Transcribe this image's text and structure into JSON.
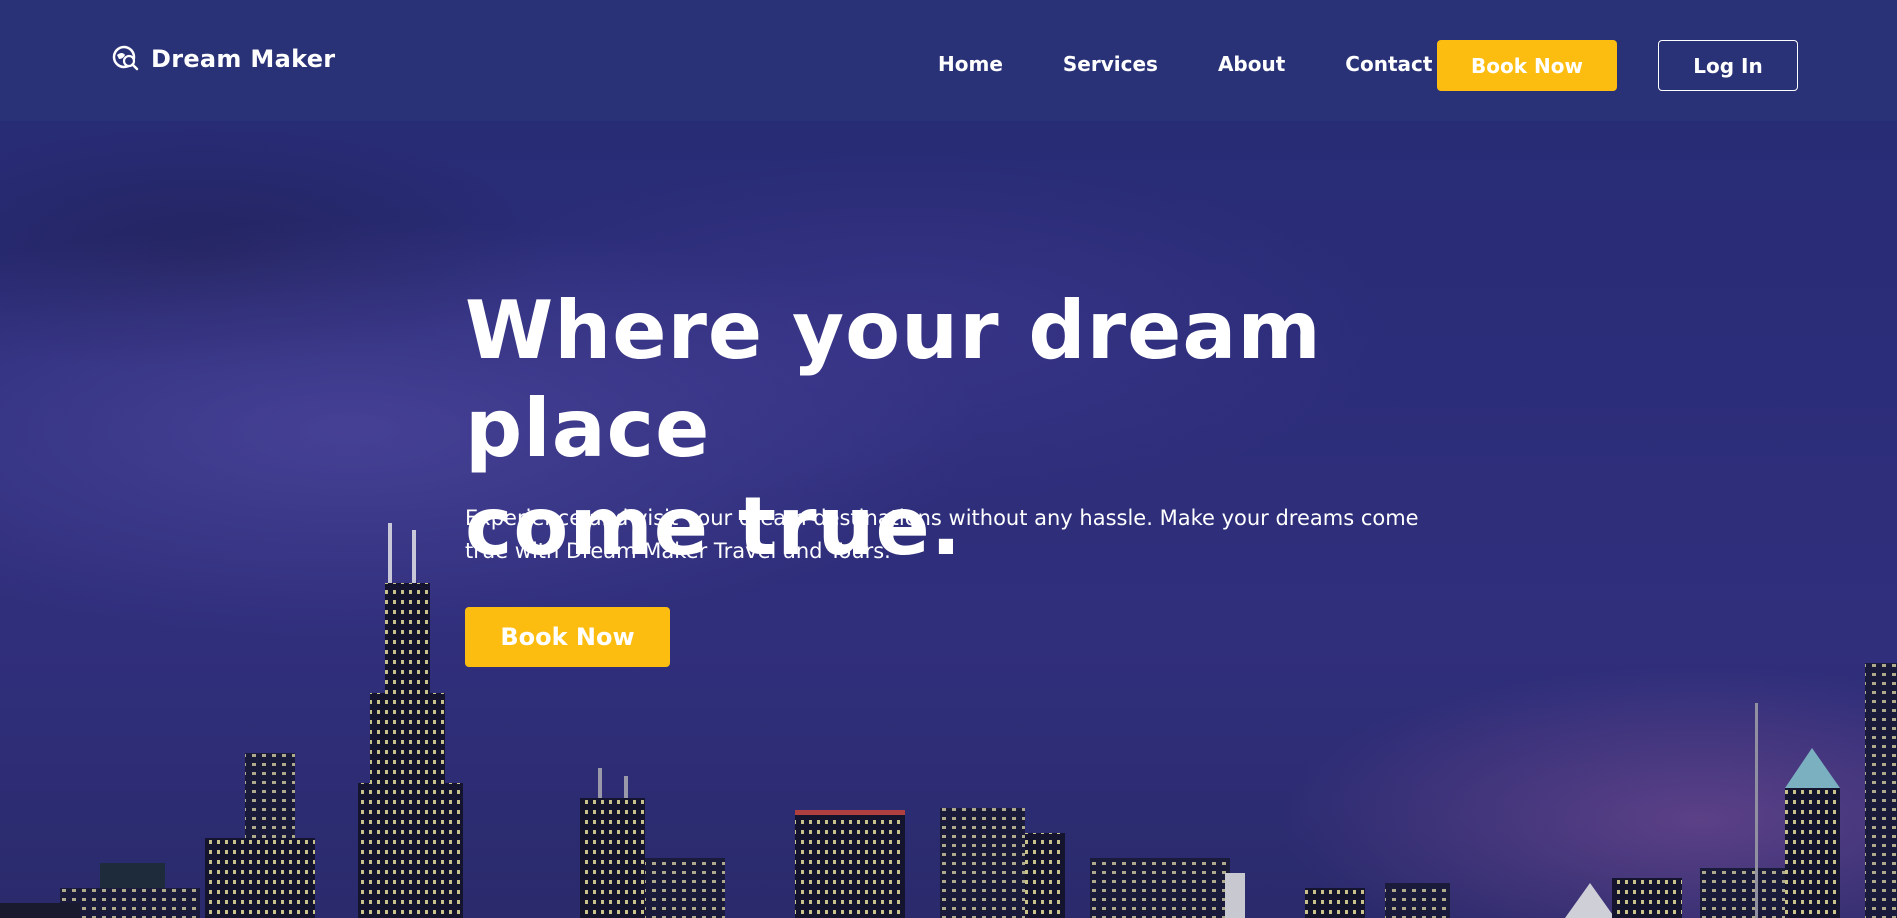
{
  "brand": {
    "name": "Dream Maker",
    "icon": "globe-search-icon"
  },
  "nav": {
    "links": [
      "Home",
      "Services",
      "About",
      "Contact"
    ],
    "book_label": "Book Now",
    "login_label": "Log In"
  },
  "hero": {
    "title_line1": "Where your dream place",
    "title_line2": "come true.",
    "subtitle": "Experience and visit your dream destinations without any hassle. Make your dreams come true with Dream Maker Travel and Tours.",
    "cta_label": "Book Now"
  },
  "colors": {
    "nav_bg": "#2a3277",
    "accent": "#fdbd10",
    "text": "#ffffff"
  }
}
